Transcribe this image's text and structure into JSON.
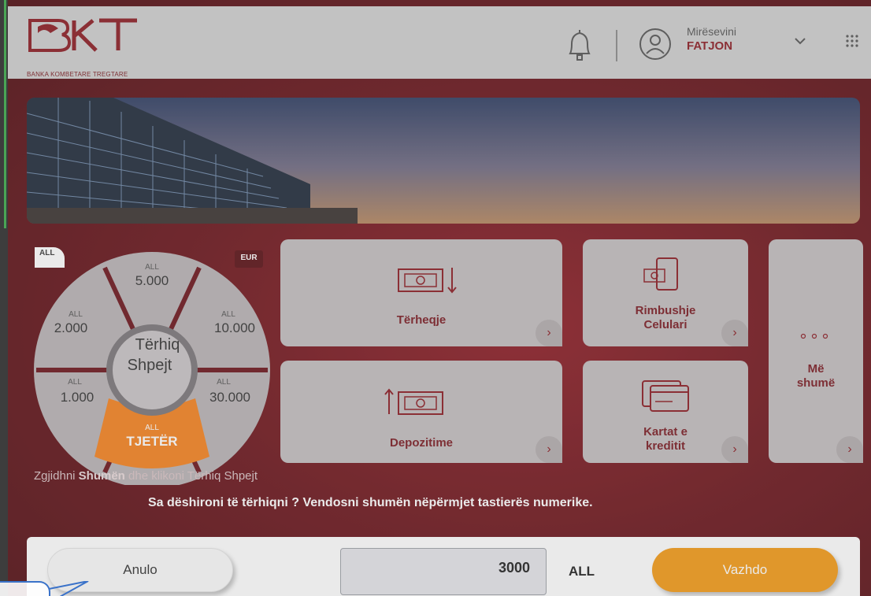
{
  "colors": {
    "brand": "#8c1b23",
    "accent": "#f39a16",
    "background": "#6c141b"
  },
  "header": {
    "logo_text": "BKT",
    "logo_subtitle": "BANKA KOMBETARE TREGTARE",
    "welcome": "Mirësevini",
    "username": "FATJON",
    "icons": [
      "bell-icon",
      "user-avatar-icon",
      "chevron-down-icon",
      "apps-grid-icon"
    ]
  },
  "quick_withdraw": {
    "badge_all": "ALL",
    "badge_eur": "EUR",
    "center_line1": "Tërhiq",
    "center_line2": "Shpejt",
    "options": [
      {
        "currency": "ALL",
        "amount": "5.000"
      },
      {
        "currency": "ALL",
        "amount": "10.000"
      },
      {
        "currency": "ALL",
        "amount": "30.000"
      },
      {
        "currency": "ALL",
        "amount": "TJETËR",
        "selected": true
      },
      {
        "currency": "ALL",
        "amount": "1.000"
      },
      {
        "currency": "ALL",
        "amount": "2.000"
      }
    ],
    "instruction_prefix": "Zgjidhni",
    "instruction_bold": "Shumën",
    "instruction_suffix": "dhe klikoni Tërhiq Shpejt"
  },
  "tiles": [
    {
      "label": "Tërheqje",
      "icon": "cash-withdraw-icon"
    },
    {
      "label_line1": "Rimbushje",
      "label_line2": "Celulari",
      "icon": "mobile-topup-icon"
    },
    {
      "label": "Depozitime",
      "icon": "cash-deposit-icon"
    },
    {
      "label_line1": "Kartat e",
      "label_line2": "kreditit",
      "icon": "credit-card-icon"
    },
    {
      "label_line1": "Më",
      "label_line2": "shumë",
      "icon": "more-dots-icon"
    }
  ],
  "prompt": "Sa dëshironi të tërhiqni ? Vendosni shumën nëpërmjet tastierës numerike.",
  "footer": {
    "cancel_label": "Anulo",
    "amount_value": "3000",
    "currency": "ALL",
    "continue_label": "Vazhdo"
  }
}
